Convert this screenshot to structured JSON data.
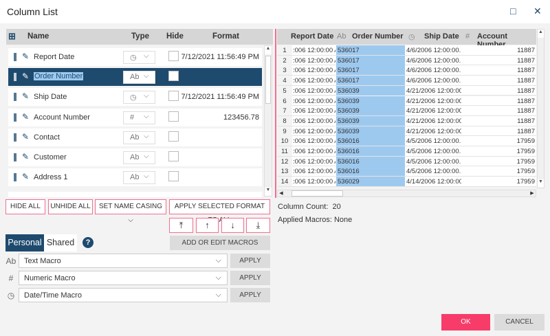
{
  "window": {
    "title": "Column List",
    "maximize_icon": "□",
    "close_icon": "✕"
  },
  "left": {
    "headers": {
      "name": "Name",
      "type": "Type",
      "hide": "Hide",
      "format": "Format"
    },
    "rows": [
      {
        "name": "Report Date",
        "type": "clock",
        "type_glyph": "◷",
        "format": "7/12/2021 11:56:49 PM",
        "selected": false
      },
      {
        "name": "Order Number",
        "type": "text",
        "type_glyph": "Ab",
        "format": "",
        "selected": true
      },
      {
        "name": "Ship Date",
        "type": "clock",
        "type_glyph": "◷",
        "format": "7/12/2021 11:56:49 PM",
        "selected": false
      },
      {
        "name": "Account Number",
        "type": "number",
        "type_glyph": "#",
        "format": "123456.78",
        "selected": false
      },
      {
        "name": "Contact",
        "type": "text",
        "type_glyph": "Ab",
        "format": "",
        "selected": false
      },
      {
        "name": "Customer",
        "type": "text",
        "type_glyph": "Ab",
        "format": "",
        "selected": false
      },
      {
        "name": "Address 1",
        "type": "text",
        "type_glyph": "Ab",
        "format": "",
        "selected": false
      }
    ]
  },
  "grid": {
    "headers": {
      "report_date": "Report Date",
      "order_type": "Ab",
      "order_number": "Order Number",
      "ship_type": "◷",
      "ship_date": "Ship Date",
      "account_type": "#",
      "account_number": "Account Number"
    },
    "rows": [
      [
        "1",
        ":006 12:00:00 AM",
        "536017",
        "4/6/2006 12:00:00...",
        "11887"
      ],
      [
        "2",
        ":006 12:00:00 AM",
        "536017",
        "4/6/2006 12:00:00...",
        "11887"
      ],
      [
        "3",
        ":006 12:00:00 AM",
        "536017",
        "4/6/2006 12:00:00...",
        "11887"
      ],
      [
        "4",
        ":006 12:00:00 AM",
        "536017",
        "4/6/2006 12:00:00...",
        "11887"
      ],
      [
        "5",
        ":006 12:00:00 AM",
        "536039",
        "4/21/2006 12:00:00...",
        "11887"
      ],
      [
        "6",
        ":006 12:00:00 AM",
        "536039",
        "4/21/2006 12:00:00...",
        "11887"
      ],
      [
        "7",
        ":006 12:00:00 AM",
        "536039",
        "4/21/2006 12:00:00...",
        "11887"
      ],
      [
        "8",
        ":006 12:00:00 AM",
        "536039",
        "4/21/2006 12:00:00...",
        "11887"
      ],
      [
        "9",
        ":006 12:00:00 AM",
        "536039",
        "4/21/2006 12:00:00...",
        "11887"
      ],
      [
        "10",
        ":006 12:00:00 AM",
        "536016",
        "4/5/2006 12:00:00...",
        "17959"
      ],
      [
        "11",
        ":006 12:00:00 AM",
        "536016",
        "4/5/2006 12:00:00...",
        "17959"
      ],
      [
        "12",
        ":006 12:00:00 AM",
        "536016",
        "4/5/2006 12:00:00...",
        "17959"
      ],
      [
        "13",
        ":006 12:00:00 AM",
        "536016",
        "4/5/2006 12:00:00...",
        "17959"
      ],
      [
        "14",
        ":006 12:00:00 AM",
        "536029",
        "4/14/2006 12:00:00...",
        "17959"
      ]
    ]
  },
  "buttons": {
    "hide_all": "HIDE ALL",
    "unhide_all": "UNHIDE ALL",
    "set_name_casing": "SET NAME CASING ⌵",
    "apply_format": "APPLY SELECTED FORMAT TO ALL",
    "move_top": "⤒",
    "move_up": "↑",
    "move_down": "↓",
    "move_bottom": "⤓",
    "add_macros": "ADD OR EDIT MACROS",
    "ok": "OK",
    "cancel": "CANCEL"
  },
  "info": {
    "column_count_label": "Column Count:",
    "column_count": "20",
    "applied_macros_label": "Applied Macros:",
    "applied_macros": "None"
  },
  "tabs": {
    "personal": "Personal",
    "shared": "Shared",
    "help": "?"
  },
  "macros": [
    {
      "icon": "Ab",
      "value": "Text Macro",
      "apply": "APPLY"
    },
    {
      "icon": "#",
      "value": "Numeric Macro",
      "apply": "APPLY"
    },
    {
      "icon": "◷",
      "value": "Date/Time Macro",
      "apply": "APPLY"
    }
  ],
  "colors": {
    "accent": "#1e4a6e",
    "ok": "#f73c6a",
    "selection": "#9ec9ef"
  }
}
